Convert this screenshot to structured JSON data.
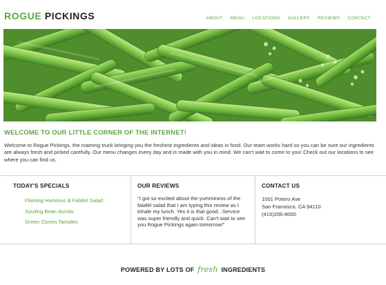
{
  "brand": {
    "part1": "ROGUE",
    "part2": "PICKINGS"
  },
  "nav": {
    "items": [
      "ABOUT",
      "MENU",
      "LOCATIONS",
      "GALLERY",
      "REVIEWS",
      "CONTACT"
    ]
  },
  "welcome": {
    "title": "WELCOME TO OUR LITTLE CORNER OF THE INTERNET!",
    "text": "Welcome to Rogue Pickings, the roaming truck bringing you the freshest ingredients and ideas in food. Our team works hard so you can be sure our ingredients are always fresh and picked carefully. Our menu changes every day and is made with you in mind. We can't wait to come to you! Check out our locations to see where you can find us."
  },
  "specials": {
    "heading": "TODAY'S SPECIALS",
    "items": [
      "Flaming Hummus & Falafel Salad",
      "Sizzling Bean Burrito",
      "Green Cloves Tamales"
    ]
  },
  "reviews": {
    "heading": "OUR REVIEWS",
    "text": "\"I got so excited about the yumminess of the falafel salad that I am typing this review as I inhale my lunch. Yes it is that good...Service was super friendly and quick. Can't wait to see you Rogue Pickings again tomorrow!\""
  },
  "contact": {
    "heading": "CONTACT US",
    "address1": "1001 Potero Ave",
    "address2": "San Fransisco, CA 94110",
    "phone": "(415)206-8000"
  },
  "footer": {
    "prefix": "POWERED BY LOTS OF",
    "script_word": "fresh",
    "suffix": "INGREDIENTS"
  },
  "colors": {
    "accent": "#5aa642",
    "text": "#333333",
    "heading": "#222222",
    "divider": "#cfcfcf"
  }
}
